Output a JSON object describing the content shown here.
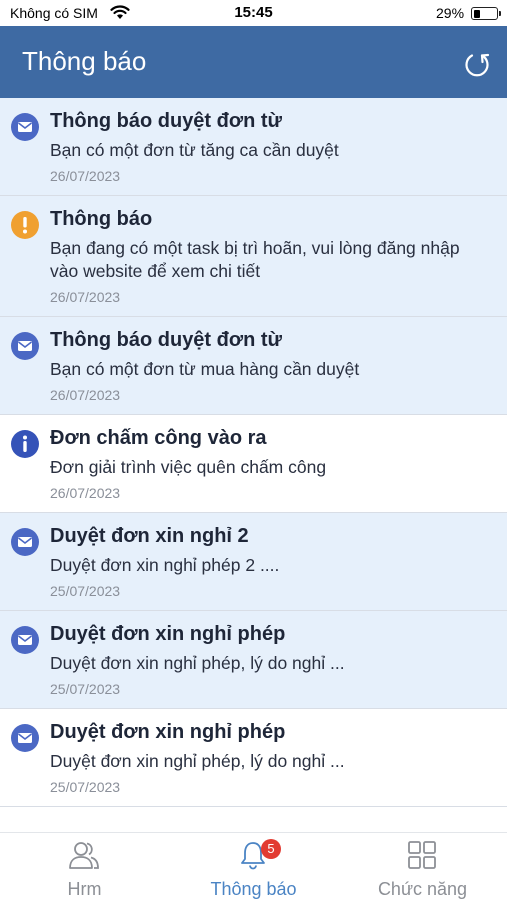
{
  "status_bar": {
    "carrier": "Không có SIM",
    "time": "15:45",
    "battery_percent": "29%",
    "battery_level": 0.29
  },
  "header": {
    "title": "Thông báo",
    "refresh_icon": "refresh-icon"
  },
  "colors": {
    "header_bg": "#3e6aa3",
    "unread_bg": "#e6f0fb",
    "mail_icon": "#4b68c4",
    "warning_icon": "#f0a030",
    "info_icon": "#3553b8",
    "active_tab": "#4b84c4",
    "badge": "#e23b32"
  },
  "notifications": [
    {
      "icon": "mail-icon",
      "title": "Thông báo duyệt đơn từ",
      "body": "Bạn có một đơn từ tăng ca cần duyệt",
      "date": "26/07/2023",
      "unread": true
    },
    {
      "icon": "warning-icon",
      "title": "Thông báo",
      "body": "Bạn đang có một task bị trì hoãn, vui lòng đăng nhập vào website để xem chi tiết",
      "date": "26/07/2023",
      "unread": true
    },
    {
      "icon": "mail-icon",
      "title": "Thông báo duyệt đơn từ",
      "body": "Bạn có một đơn từ mua hàng cần duyệt",
      "date": "26/07/2023",
      "unread": true
    },
    {
      "icon": "info-icon",
      "title": "Đơn chấm công vào ra",
      "body": "Đơn giải trình việc quên chấm công",
      "date": "26/07/2023",
      "unread": false
    },
    {
      "icon": "mail-icon",
      "title": "Duyệt đơn xin nghỉ 2",
      "body": "Duyệt đơn xin nghỉ phép 2 ....",
      "date": "25/07/2023",
      "unread": true
    },
    {
      "icon": "mail-icon",
      "title": "Duyệt đơn xin nghỉ phép",
      "body": "Duyệt đơn xin nghỉ phép, lý do nghỉ ...",
      "date": "25/07/2023",
      "unread": true
    },
    {
      "icon": "mail-icon",
      "title": "Duyệt đơn xin nghỉ phép",
      "body": "Duyệt đơn xin nghỉ phép, lý do nghỉ ...",
      "date": "25/07/2023",
      "unread": false
    }
  ],
  "tab_bar": {
    "tabs": [
      {
        "label": "Hrm",
        "icon": "people-icon",
        "active": false
      },
      {
        "label": "Thông báo",
        "icon": "bell-icon",
        "active": true,
        "badge": "5"
      },
      {
        "label": "Chức năng",
        "icon": "grid-icon",
        "active": false
      }
    ]
  }
}
